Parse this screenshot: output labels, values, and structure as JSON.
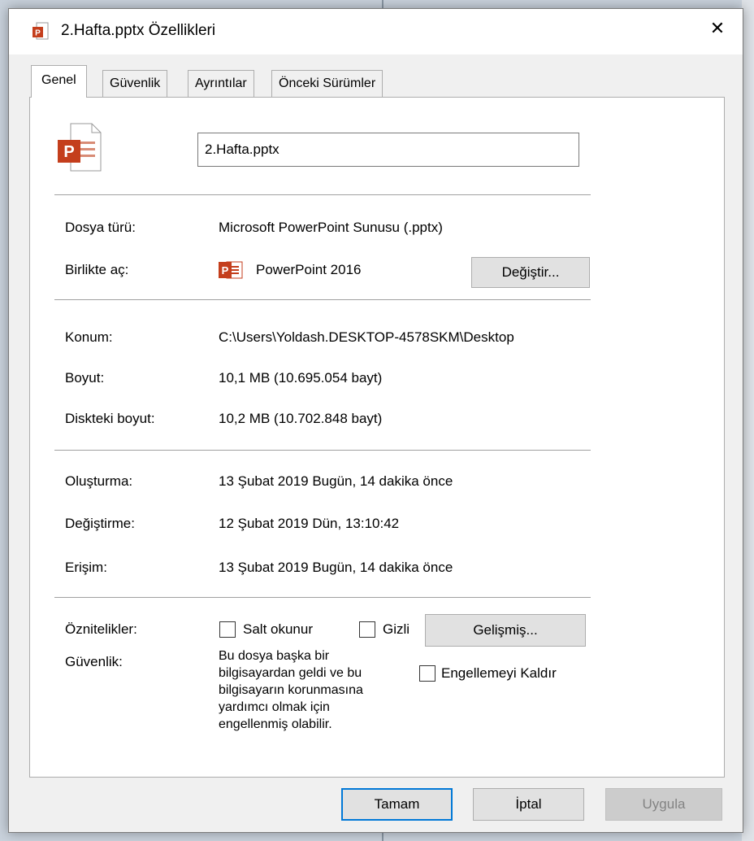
{
  "window": {
    "title": "2.Hafta.pptx Özellikleri",
    "close_glyph": "✕"
  },
  "tabs": [
    {
      "label": "Genel"
    },
    {
      "label": "Güvenlik"
    },
    {
      "label": "Ayrıntılar"
    },
    {
      "label": "Önceki Sürümler"
    }
  ],
  "general": {
    "file_name": "2.Hafta.pptx",
    "file_type": {
      "label": "Dosya türü:",
      "value": "Microsoft PowerPoint Sunusu (.pptx)"
    },
    "opens_with": {
      "label": "Birlikte aç:",
      "value": "PowerPoint 2016",
      "change_button": "Değiştir..."
    },
    "location": {
      "label": "Konum:",
      "value": "C:\\Users\\Yoldash.DESKTOP-4578SKM\\Desktop"
    },
    "size": {
      "label": "Boyut:",
      "value": "10,1 MB (10.695.054 bayt)"
    },
    "size_on_disk": {
      "label": "Diskteki boyut:",
      "value": "10,2 MB (10.702.848 bayt)"
    },
    "created": {
      "label": "Oluşturma:",
      "value": "13 Şubat 2019 Bugün, 14 dakika önce"
    },
    "modified": {
      "label": "Değiştirme:",
      "value": "12 Şubat 2019 Dün, 13:10:42"
    },
    "accessed": {
      "label": "Erişim:",
      "value": "13 Şubat 2019 Bugün, 14 dakika önce"
    },
    "attributes": {
      "label": "Öznitelikler:",
      "read_only": "Salt okunur",
      "hidden": "Gizli",
      "advanced_button": "Gelişmiş..."
    },
    "security": {
      "label": "Güvenlik:",
      "message_lines": [
        "Bu dosya başka bir",
        "bilgisayardan geldi ve bu",
        "bilgisayarın korunmasına",
        "yardımcı olmak için",
        "engellenmiş olabilir."
      ],
      "unblock": "Engellemeyi Kaldır"
    }
  },
  "buttons": {
    "ok": "Tamam",
    "cancel": "İptal",
    "apply": "Uygula"
  },
  "colors": {
    "powerpoint_red": "#c43e1c",
    "focus_blue": "#0078d7"
  },
  "icons": {
    "title": "powerpoint-file-icon",
    "file": "powerpoint-document-icon",
    "app": "powerpoint-app-icon",
    "close": "close-icon"
  }
}
